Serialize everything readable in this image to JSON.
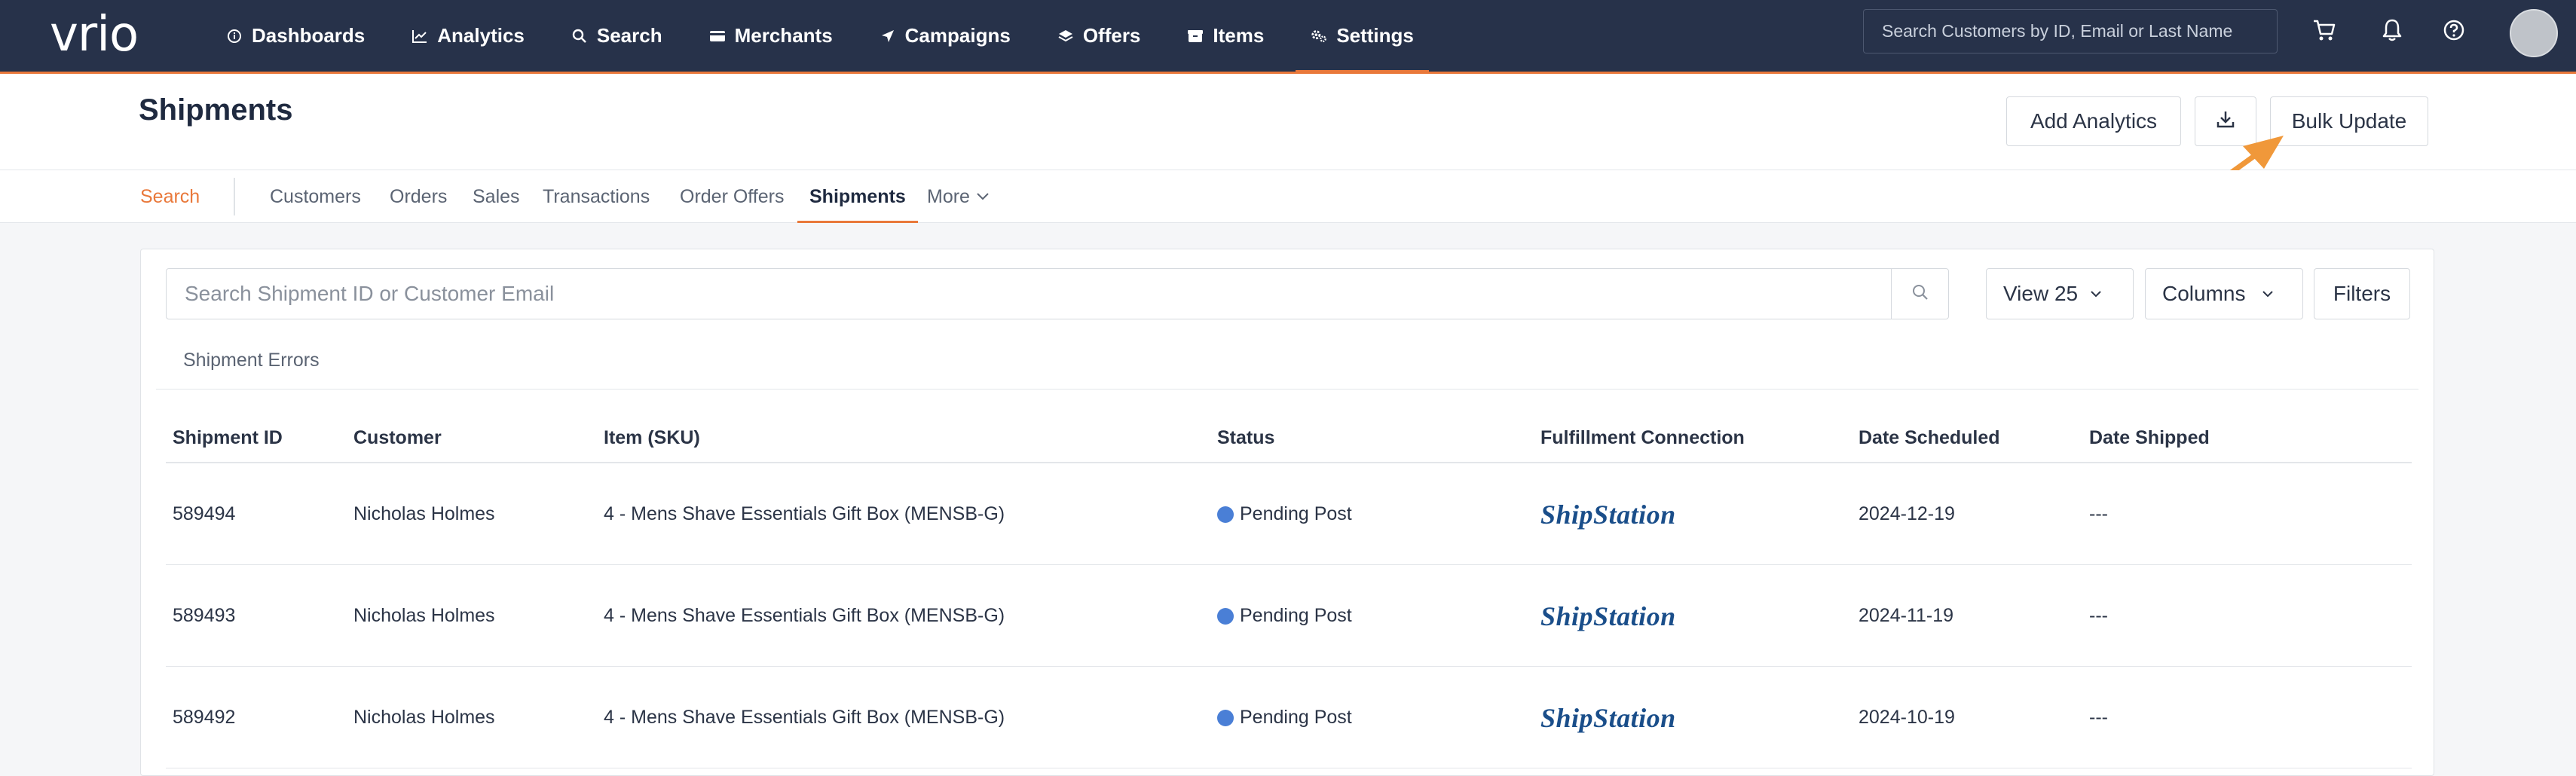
{
  "app": {
    "logo_text": "vrio"
  },
  "topnav": {
    "items": [
      {
        "label": "Dashboards",
        "icon": "info-circle-icon"
      },
      {
        "label": "Analytics",
        "icon": "line-chart-icon"
      },
      {
        "label": "Search",
        "icon": "search-icon"
      },
      {
        "label": "Merchants",
        "icon": "credit-card-icon"
      },
      {
        "label": "Campaigns",
        "icon": "paper-plane-icon"
      },
      {
        "label": "Offers",
        "icon": "layers-icon"
      },
      {
        "label": "Items",
        "icon": "box-icon"
      },
      {
        "label": "Settings",
        "icon": "gears-icon",
        "active": true
      }
    ],
    "search_placeholder": "Search Customers by ID, Email or Last Name"
  },
  "page": {
    "title": "Shipments",
    "buttons": {
      "add_analytics": "Add Analytics",
      "bulk_update": "Bulk Update"
    }
  },
  "subnav": {
    "search": "Search",
    "items": [
      "Customers",
      "Orders",
      "Sales",
      "Transactions",
      "Order Offers",
      "Shipments",
      "More"
    ],
    "active": "Shipments"
  },
  "toolbar": {
    "search_placeholder": "Search Shipment ID or Customer Email",
    "view_label": "View 25",
    "columns_label": "Columns",
    "filters_label": "Filters"
  },
  "tabs": {
    "shipment_errors": "Shipment Errors"
  },
  "table": {
    "columns": [
      "Shipment ID",
      "Customer",
      "Item (SKU)",
      "Status",
      "Fulfillment Connection",
      "Date Scheduled",
      "Date Shipped"
    ],
    "rows": [
      {
        "id": "589494",
        "customer": "Nicholas Holmes",
        "item": "4 - Mens Shave Essentials Gift Box (MENSB-G)",
        "status": "Pending Post",
        "connection": "ShipStation",
        "scheduled": "2024-12-19",
        "shipped": "---"
      },
      {
        "id": "589493",
        "customer": "Nicholas Holmes",
        "item": "4 - Mens Shave Essentials Gift Box (MENSB-G)",
        "status": "Pending Post",
        "connection": "ShipStation",
        "scheduled": "2024-11-19",
        "shipped": "---"
      },
      {
        "id": "589492",
        "customer": "Nicholas Holmes",
        "item": "4 - Mens Shave Essentials Gift Box (MENSB-G)",
        "status": "Pending Post",
        "connection": "ShipStation",
        "scheduled": "2024-10-19",
        "shipped": "---"
      }
    ]
  },
  "colors": {
    "nav_bg": "#27324a",
    "accent": "#e9783a",
    "status_pending": "#4a7fd6"
  }
}
